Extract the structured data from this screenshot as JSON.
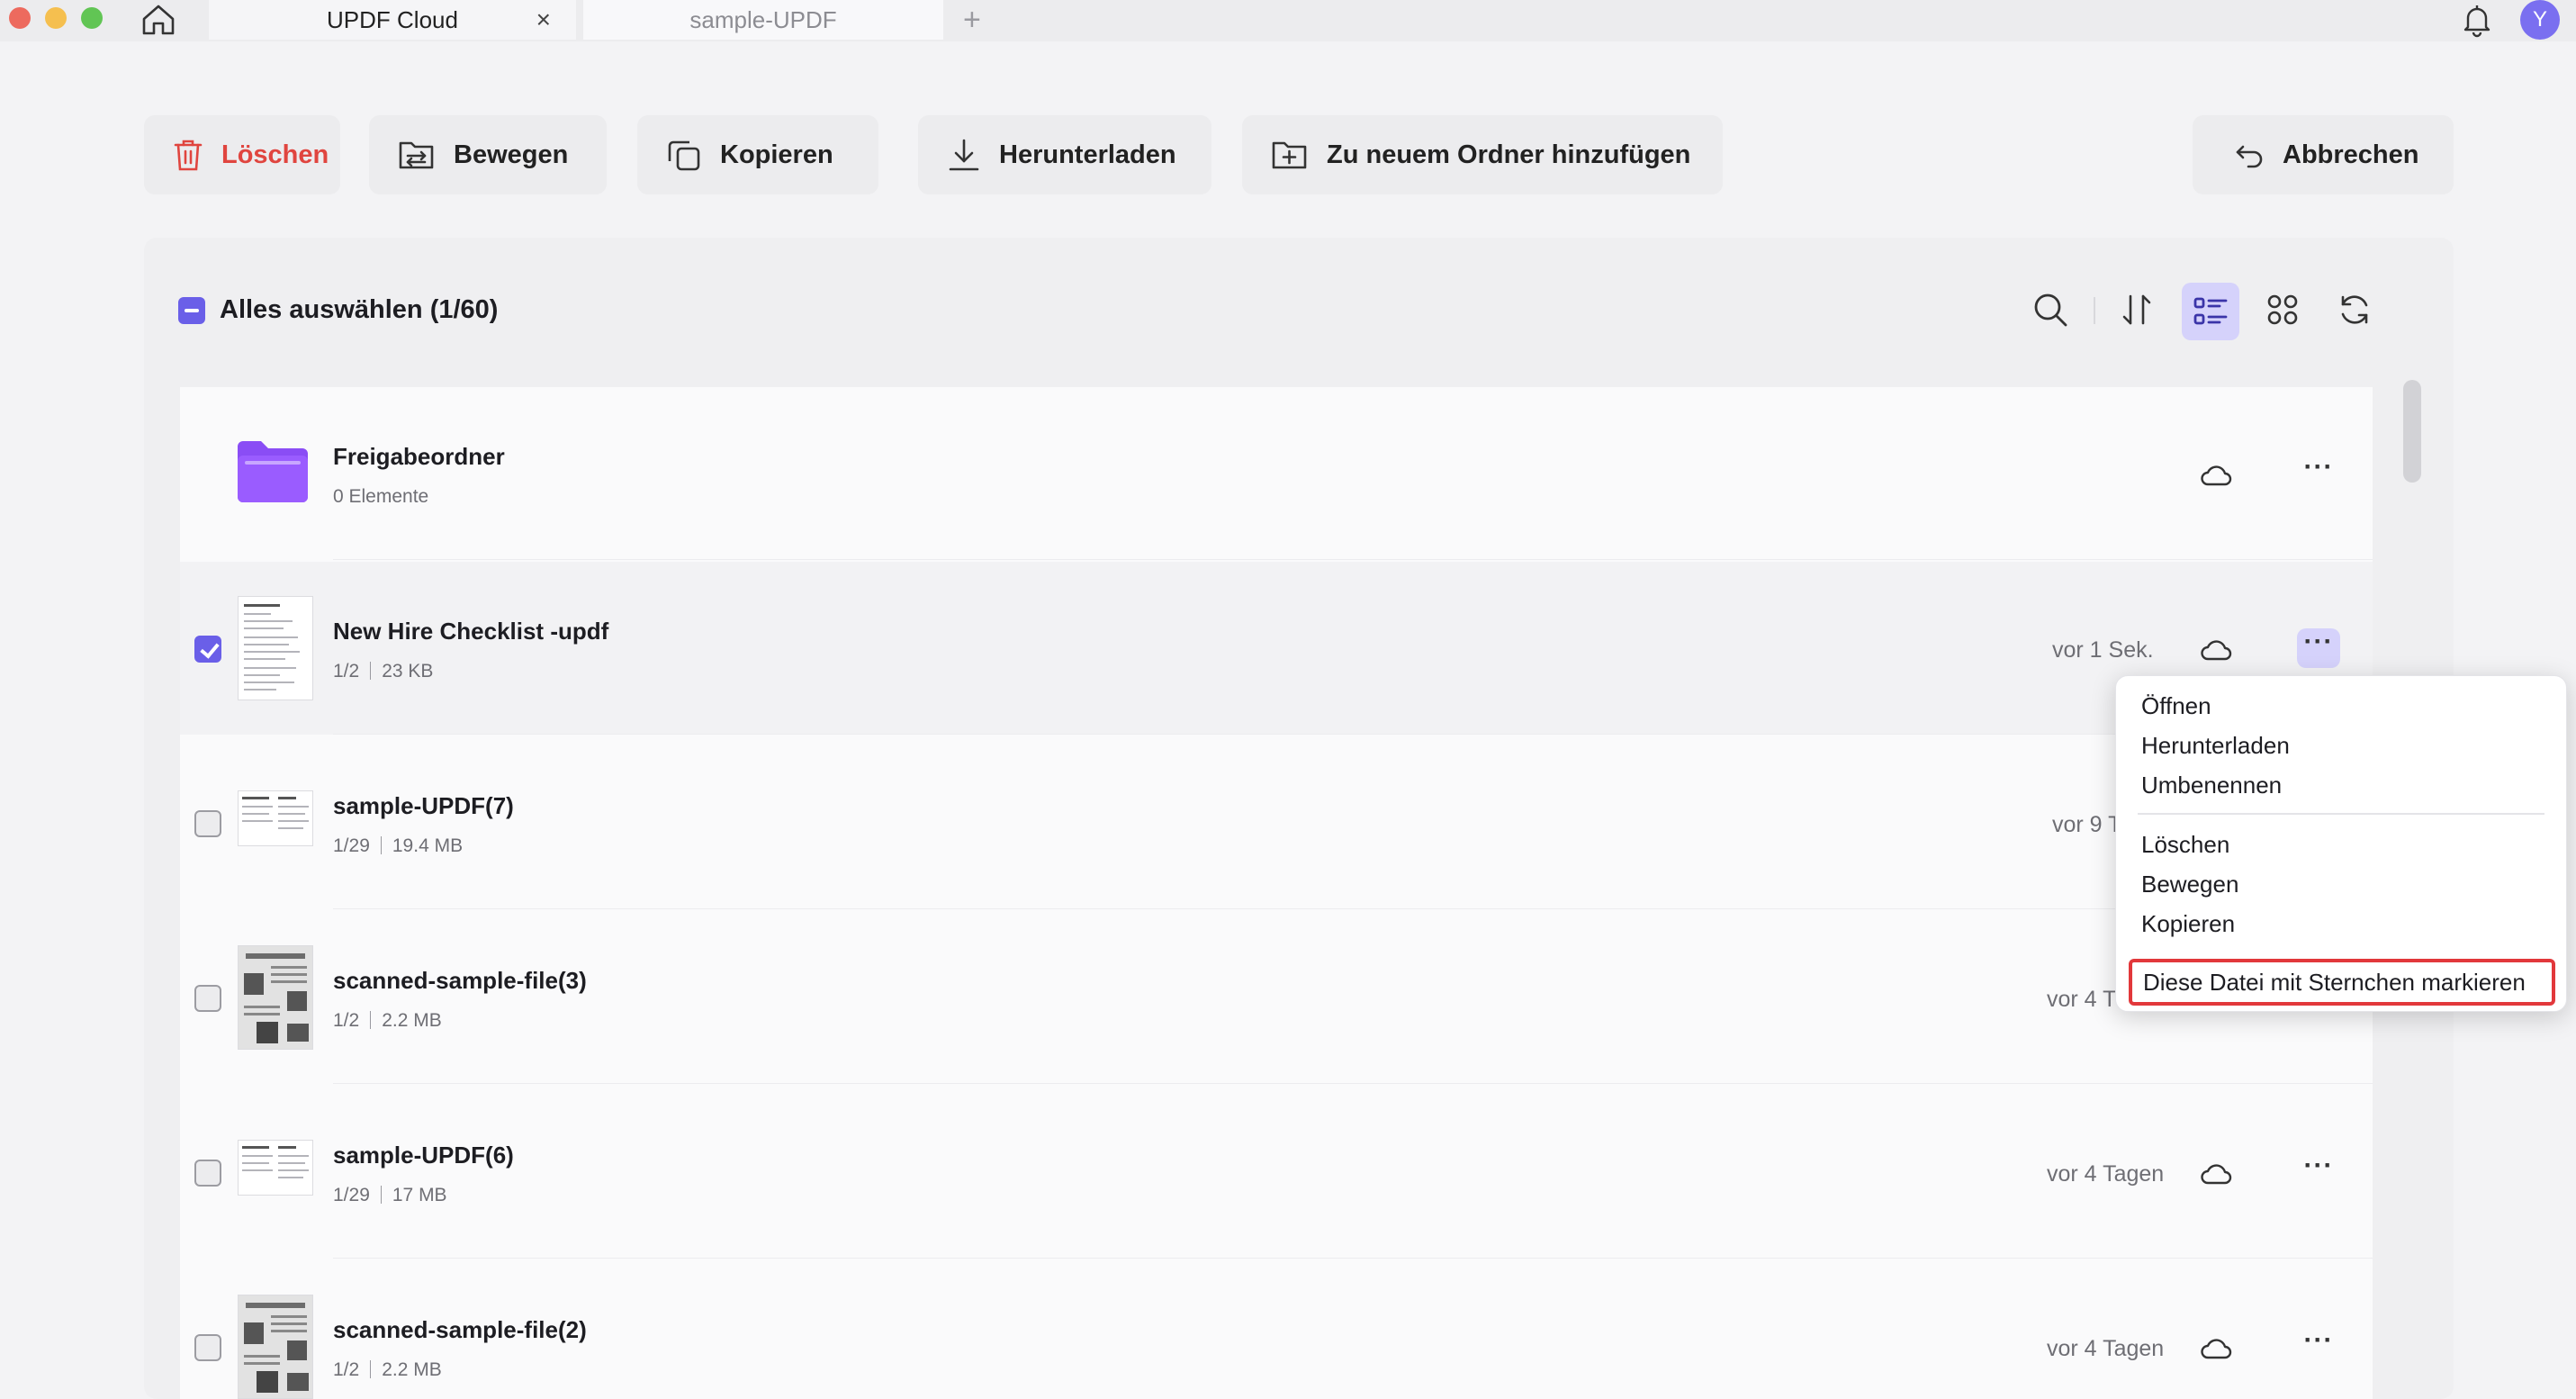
{
  "colors": {
    "accent": "#6a5fe8",
    "accent_light": "#d5d2fb",
    "danger": "#e0453f",
    "highlight_border": "#e2383b",
    "traffic_close": "#ed6a5e",
    "traffic_minimize": "#f5bf4f",
    "traffic_zoom": "#61c554",
    "folder": "#8a4df5"
  },
  "tabs": [
    {
      "label": "UPDF Cloud",
      "active": true
    },
    {
      "label": "sample-UPDF",
      "active": false
    }
  ],
  "tab_close": "×",
  "tab_add": "+",
  "user": {
    "initial": "Y"
  },
  "toolbar": {
    "delete_label": "Löschen",
    "move_label": "Bewegen",
    "copy_label": "Kopieren",
    "download_label": "Herunterladen",
    "add_folder_label": "Zu neuem Ordner hinzufügen",
    "cancel_label": "Abbrechen"
  },
  "list_header": {
    "select_all_label": "Alles auswählen (1/60)"
  },
  "icons": {
    "search": "search-icon",
    "sort": "sort-icon",
    "list_view": "list-view-icon",
    "grid_view": "grid-view-icon",
    "refresh": "refresh-icon"
  },
  "files": [
    {
      "name": "Freigabeordner",
      "meta": "0 Elemente",
      "type": "folder"
    },
    {
      "name": "New Hire Checklist -updf",
      "pages": "1/2",
      "size": "23 KB",
      "time": "vor 1 Sek.",
      "checked": true
    },
    {
      "name": "sample-UPDF(7)",
      "pages": "1/29",
      "size": "19.4 MB",
      "time": "vor 9 T",
      "checked": false
    },
    {
      "name": "scanned-sample-file(3)",
      "pages": "1/2",
      "size": "2.2 MB",
      "time": "vor 4 T",
      "checked": false
    },
    {
      "name": "sample-UPDF(6)",
      "pages": "1/29",
      "size": "17 MB",
      "time": "vor 4 Tagen",
      "checked": false
    },
    {
      "name": "scanned-sample-file(2)",
      "pages": "1/2",
      "size": "2.2 MB",
      "time": "vor 4 Tagen",
      "checked": false
    }
  ],
  "more_dots": "···",
  "context_menu": {
    "open": "Öffnen",
    "download": "Herunterladen",
    "rename": "Umbenennen",
    "delete": "Löschen",
    "move": "Bewegen",
    "copy": "Kopieren",
    "star": "Diese Datei mit Sternchen markieren"
  }
}
